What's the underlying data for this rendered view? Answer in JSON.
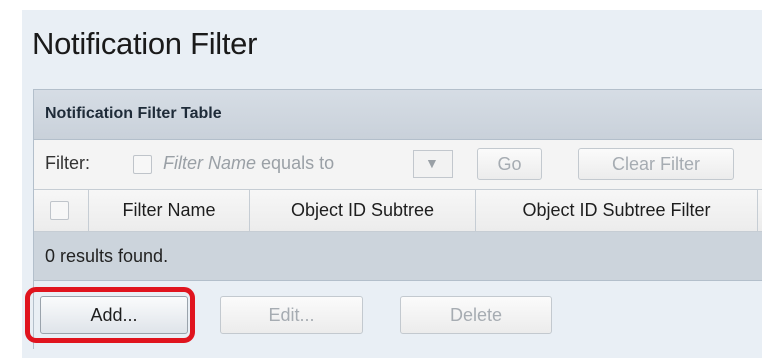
{
  "page": {
    "title": "Notification Filter"
  },
  "table": {
    "title": "Notification Filter Table",
    "filter": {
      "label": "Filter:",
      "field_name": "Filter Name",
      "operator": "equals to",
      "dropdown_icon": "triangle-down-icon",
      "go_label": "Go",
      "clear_label": "Clear Filter"
    },
    "columns": [
      "Filter Name",
      "Object ID Subtree",
      "Object ID Subtree Filter"
    ],
    "results_text": "0 results found.",
    "actions": {
      "add_label": "Add...",
      "edit_label": "Edit...",
      "delete_label": "Delete"
    }
  },
  "colors": {
    "highlight": "#e0141e",
    "panel": "#e9eff5",
    "results_bg": "#ccd4dc"
  }
}
